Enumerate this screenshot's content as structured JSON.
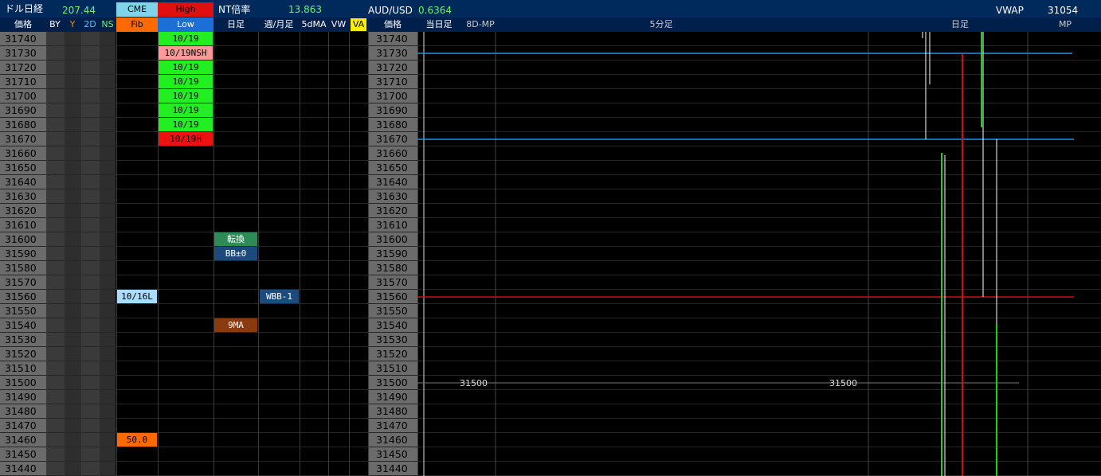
{
  "header": {
    "app_label": "ドル日経",
    "value_207": "207.44",
    "cme_label": "CME",
    "high_label": "High",
    "nt_label": "NT倍率",
    "nt_value": "13.863",
    "audusd_label": "AUD/USD",
    "audusd_value": "0.6364",
    "vwap_label": "VWAP",
    "vwap_value": "31054"
  },
  "subheader": {
    "price_label": "価格",
    "by": "BY",
    "y": "Y",
    "twod": "2D",
    "ns": "NS",
    "fib": "Fib",
    "low": "Low",
    "daily": "日足",
    "weekly_monthly": "週/月足",
    "fivedma": "5dMA",
    "vw": "VW",
    "va": "VA",
    "price_label2": "価格",
    "today": "当日足",
    "eightd_mp": "8D-MP",
    "fivemin": "5分足",
    "daily2": "日足",
    "mp": "MP"
  },
  "prices": [
    "31740",
    "31730",
    "31720",
    "31710",
    "31700",
    "31690",
    "31680",
    "31670",
    "31660",
    "31650",
    "31640",
    "31630",
    "31620",
    "31610",
    "31600",
    "31590",
    "31580",
    "31570",
    "31560",
    "31550",
    "31540",
    "31530",
    "31520",
    "31510",
    "31500",
    "31490",
    "31480",
    "31470",
    "31460",
    "31450",
    "31440"
  ],
  "tags": {
    "low_col": [
      {
        "row": 0,
        "text": "10/19",
        "color": "#22ee22",
        "fg": "#000"
      },
      {
        "row": 1,
        "text": "10/19NSH",
        "color": "#ff9999",
        "fg": "#000"
      },
      {
        "row": 2,
        "text": "10/19",
        "color": "#22ee22",
        "fg": "#000"
      },
      {
        "row": 3,
        "text": "10/19",
        "color": "#22ee22",
        "fg": "#000"
      },
      {
        "row": 4,
        "text": "10/19",
        "color": "#22ee22",
        "fg": "#000"
      },
      {
        "row": 5,
        "text": "10/19",
        "color": "#22ee22",
        "fg": "#000"
      },
      {
        "row": 6,
        "text": "10/19",
        "color": "#22ee22",
        "fg": "#000"
      },
      {
        "row": 7,
        "text": "10/19H",
        "color": "#ee1111",
        "fg": "#000"
      }
    ],
    "fib_col": [
      {
        "row": 18,
        "text": "10/16L",
        "color": "#aaddff",
        "fg": "#000"
      },
      {
        "row": 28,
        "text": "50.0",
        "color": "#ff6a00",
        "fg": "#000"
      }
    ],
    "daily_col": [
      {
        "row": 14,
        "text": "転換",
        "color": "#2e8b57",
        "fg": "#fff"
      },
      {
        "row": 15,
        "text": "BB±0",
        "color": "#1c4a7a",
        "fg": "#fff"
      },
      {
        "row": 20,
        "text": "9MA",
        "color": "#8b3a0f",
        "fg": "#fff"
      }
    ],
    "weekly_col": [
      {
        "row": 18,
        "text": "WBB-1",
        "color": "#1c4a7a",
        "fg": "#fff"
      }
    ]
  },
  "chart_labels": {
    "level_a": "31500",
    "level_b": "31500"
  },
  "colors": {
    "green": "#22cc22",
    "red": "#cc1111",
    "blue_line": "#2a8fd0"
  }
}
